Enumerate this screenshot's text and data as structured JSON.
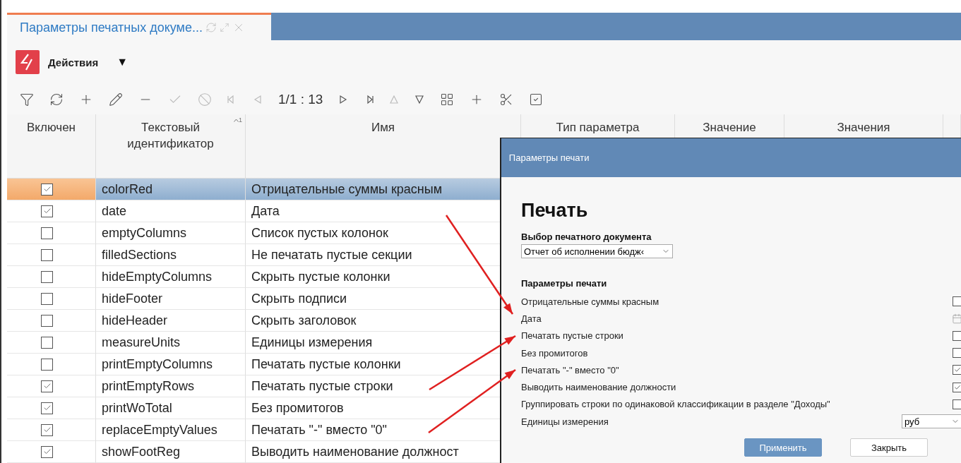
{
  "tab": {
    "title": "Параметры печатных докуме...",
    "selected": true
  },
  "actions": {
    "label": "Действия",
    "caret": "▼"
  },
  "toolbar": {
    "pager": "1/1 : 13"
  },
  "table": {
    "columns": [
      {
        "label": "Включен"
      },
      {
        "label": "Текстовый идентификатор",
        "sort": "1"
      },
      {
        "label": "Имя"
      },
      {
        "label": "Тип параметра"
      },
      {
        "label": "Значение"
      },
      {
        "label": "Значения"
      }
    ],
    "rows": [
      {
        "enabled": true,
        "id": "colorRed",
        "name": "Отрицательные суммы красным",
        "selected": true
      },
      {
        "enabled": true,
        "id": "date",
        "name": "Дата",
        "selected": false
      },
      {
        "enabled": false,
        "id": "emptyColumns",
        "name": "Список пустых колонок",
        "selected": false
      },
      {
        "enabled": false,
        "id": "filledSections",
        "name": "Не печатать пустые секции",
        "selected": false
      },
      {
        "enabled": false,
        "id": "hideEmptyColumns",
        "name": "Скрыть пустые колонки",
        "selected": false
      },
      {
        "enabled": false,
        "id": "hideFooter",
        "name": "Скрыть подписи",
        "selected": false
      },
      {
        "enabled": false,
        "id": "hideHeader",
        "name": "Скрыть заголовок",
        "selected": false
      },
      {
        "enabled": false,
        "id": "measureUnits",
        "name": "Единицы измерения",
        "selected": false
      },
      {
        "enabled": false,
        "id": "printEmptyColumns",
        "name": "Печатать пустые колонки",
        "selected": false
      },
      {
        "enabled": true,
        "id": "printEmptyRows",
        "name": "Печатать пустые строки",
        "selected": false
      },
      {
        "enabled": true,
        "id": "printWoTotal",
        "name": "Без промитогов",
        "selected": false
      },
      {
        "enabled": true,
        "id": "replaceEmptyValues",
        "name": "Печатать \"-\" вместо \"0\"",
        "selected": false
      },
      {
        "enabled": true,
        "id": "showFootReg",
        "name": "Выводить наименование должност",
        "selected": false
      }
    ]
  },
  "dialog": {
    "title": "Параметры печати",
    "heading": "Печать",
    "doc_label": "Выбор печатного документа",
    "doc_value": "Отчет об исполнении бюдж‹",
    "params_label": "Параметры печати",
    "params": [
      {
        "kind": "checkbox",
        "label": "Отрицательные суммы красным",
        "checked": false
      },
      {
        "kind": "date",
        "label": "Дата"
      },
      {
        "kind": "checkbox",
        "label": "Печатать пустые строки",
        "checked": false
      },
      {
        "kind": "checkbox",
        "label": "Без промитогов",
        "checked": false
      },
      {
        "kind": "checkbox",
        "label": "Печатать \"-\" вместо \"0\"",
        "checked": true
      },
      {
        "kind": "checkbox",
        "label": "Выводить наименование должности",
        "checked": true
      },
      {
        "kind": "checkbox",
        "label": "Группировать строки по одинаковой классификации в разделе \"Доходы\"",
        "checked": false
      },
      {
        "kind": "select",
        "label": "Единицы измерения",
        "value": "руб"
      }
    ],
    "buttons": [
      {
        "label": "Применить",
        "primary": true
      },
      {
        "label": "Закрыть",
        "primary": false
      }
    ]
  }
}
